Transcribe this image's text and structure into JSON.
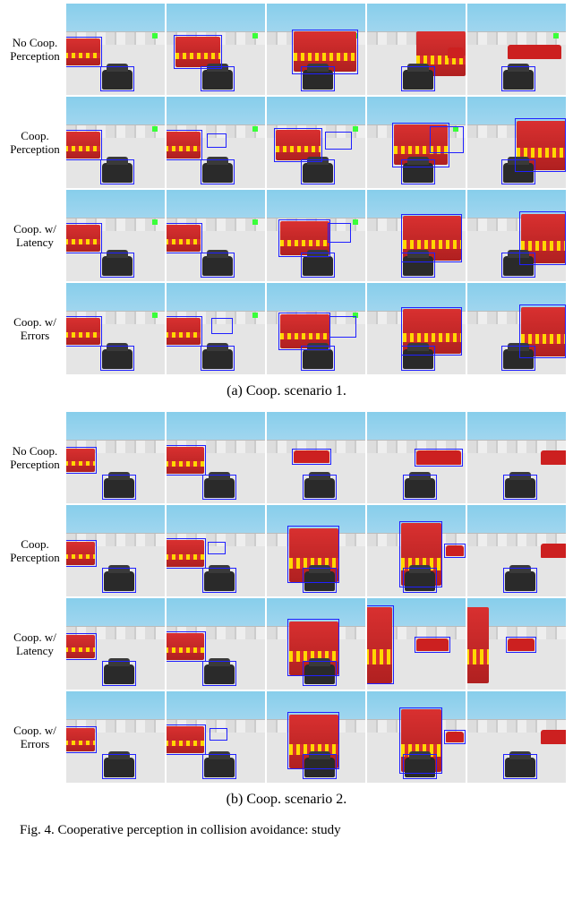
{
  "figure": {
    "number": "Fig. 4.",
    "caption_fragment": "Cooperative perception in collision avoidance: study",
    "scenarios": [
      {
        "id": "a",
        "label": "(a) Coop. scenario 1.",
        "rows": [
          {
            "label": "No Coop.\nPerception"
          },
          {
            "label": "Coop.\nPerception"
          },
          {
            "label": "Coop. w/\nLatency"
          },
          {
            "label": "Coop. w/\nErrors"
          }
        ],
        "cols": 5
      },
      {
        "id": "b",
        "label": "(b) Coop. scenario 2.",
        "rows": [
          {
            "label": "No Coop.\nPerception"
          },
          {
            "label": "Coop.\nPerception"
          },
          {
            "label": "Coop. w/\nLatency"
          },
          {
            "label": "Coop. w/\nErrors"
          }
        ],
        "cols": 5
      }
    ]
  }
}
